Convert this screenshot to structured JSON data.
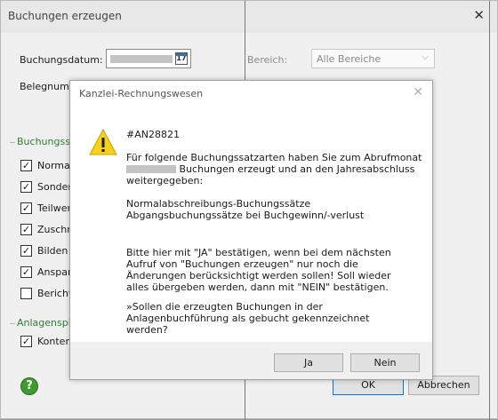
{
  "bg_window": {
    "title": "Buchungen erzeugen",
    "close_glyph": "✕",
    "buchungsdatum_label": "Buchungsdatum:",
    "bereich_label": "Bereich:",
    "bereich_value": "Alle Bereiche",
    "belegnummer_label": "Belegnumme",
    "section_buchung": "Buchungssä",
    "section_anlagen": "Anlagenspie",
    "checkboxes": [
      {
        "label": "Normala",
        "checked": true
      },
      {
        "label": "Sondera",
        "checked": true
      },
      {
        "label": "Teilwert",
        "checked": true
      },
      {
        "label": "Zuschre",
        "checked": true
      },
      {
        "label": "Bilden A",
        "checked": true
      },
      {
        "label": "Anspari",
        "checked": true
      },
      {
        "label": "Berichtig",
        "checked": false
      }
    ],
    "anlagen_checkbox": {
      "label": "Kontenv",
      "checked": true
    },
    "ok_label": "OK",
    "abort_label": "Abbrechen"
  },
  "dialog": {
    "title": "Kanzlei-Rechnungswesen",
    "close_glyph": "✕",
    "code": "#AN28821",
    "text1_a": "Für folgende Buchungssatzarten haben Sie zum Abrufmonat",
    "text1_b": "Buchungen erzeugt und an den Jahresabschluss",
    "text1_c": "weitergegeben:",
    "list_1": "Normalabschreibungs-Buchungssätze",
    "list_2": "Abgangsbuchungssätze bei Buchgewinn/-verlust",
    "text2": "Bitte hier mit \"JA\" bestätigen, wenn bei dem nächsten Aufruf von \"Buchungen erzeugen\" nur noch die Änderungen berücksichtigt werden sollen! Soll wieder alles übergeben werden, dann mit \"NEIN\" bestätigen.",
    "text3": "»Sollen die erzeugten Buchungen in der Anlagenbuchführung als gebucht gekennzeichnet werden?",
    "yes_label": "Ja",
    "no_label": "Nein"
  },
  "icons": {
    "warning": "warning-icon",
    "calendar": "calendar-icon",
    "help": "help-icon",
    "check": "✓"
  },
  "colors": {
    "warning_yellow": "#f7d117",
    "section_green": "#2e7d32",
    "help_green": "#3e9b2f"
  }
}
